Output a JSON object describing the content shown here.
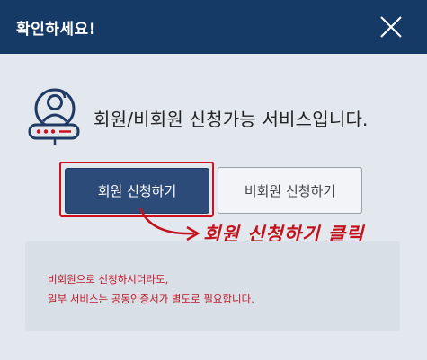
{
  "dialog": {
    "title": "확인하세요!",
    "close_icon": "close-icon"
  },
  "intro": {
    "icon": "member-id-icon",
    "text": "회원/비회원 신청가능 서비스입니다."
  },
  "buttons": {
    "member_label": "회원 신청하기",
    "guest_label": "비회원 신청하기"
  },
  "annotation": {
    "text": "회원 신청하기 클릭",
    "color": "#c4121c"
  },
  "notice": {
    "line1": "비회원으로 신청하시더라도,",
    "line2": "일부 서비스는 공동인증서가 별도로 필요합니다.",
    "color": "#c0192a"
  },
  "colors": {
    "header": "#163a66",
    "primary_button": "#2d4b78",
    "background": "#e3e8ee"
  }
}
